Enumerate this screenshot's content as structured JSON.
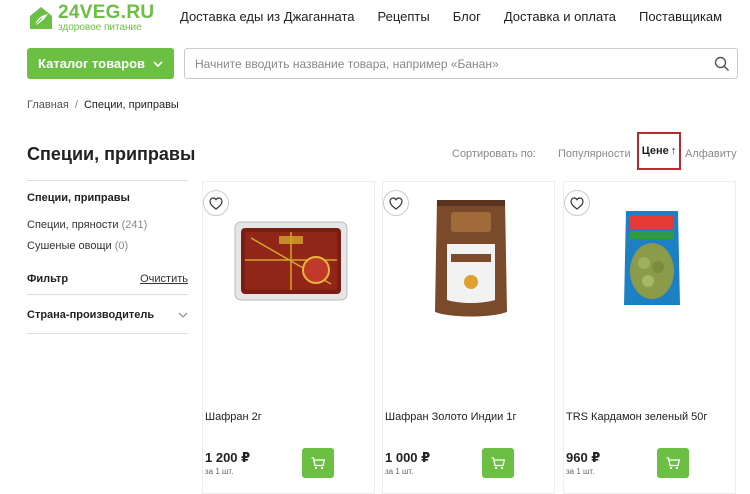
{
  "header": {
    "logo_title": "24VEG.RU",
    "logo_subtitle": "здоровое питание",
    "nav": [
      "Доставка еды из Джаганната",
      "Рецепты",
      "Блог",
      "Доставка и оплата",
      "Поставщикам"
    ]
  },
  "catalog_button": {
    "label": "Каталог товаров"
  },
  "search": {
    "placeholder": "Начните вводить название товара, например «Банан»",
    "value": ""
  },
  "breadcrumb": {
    "home": "Главная",
    "separator": "/",
    "current": "Специи, приправы"
  },
  "page_title": "Специи, приправы",
  "sort": {
    "label": "Сортировать по:",
    "popularity": "Популярности",
    "price": "Цене",
    "price_arrow": "↑",
    "alphabet": "Алфавиту"
  },
  "sidebar": {
    "section_title": "Специи, приправы",
    "links": [
      {
        "label": "Специи, пряности",
        "count": "(241)"
      },
      {
        "label": "Сушеные овощи",
        "count": "(0)"
      }
    ],
    "filter_label": "Фильтр",
    "clear_label": "Очистить",
    "country_label": "Страна-производитель"
  },
  "products": [
    {
      "name": "Шафран 2г",
      "price": "1 200 ₽",
      "unit": "за 1 шт."
    },
    {
      "name": "Шафран Золото Индии 1г",
      "price": "1 000 ₽",
      "unit": "за 1 шт."
    },
    {
      "name": "TRS Кардамон зеленый 50г",
      "price": "960 ₽",
      "unit": "за 1 шт."
    }
  ],
  "colors": {
    "accent": "#6bbf43",
    "highlight": "#c0272d"
  },
  "icons": [
    "logo-icon",
    "chevron-down-icon",
    "search-icon",
    "heart-icon",
    "cart-icon"
  ]
}
